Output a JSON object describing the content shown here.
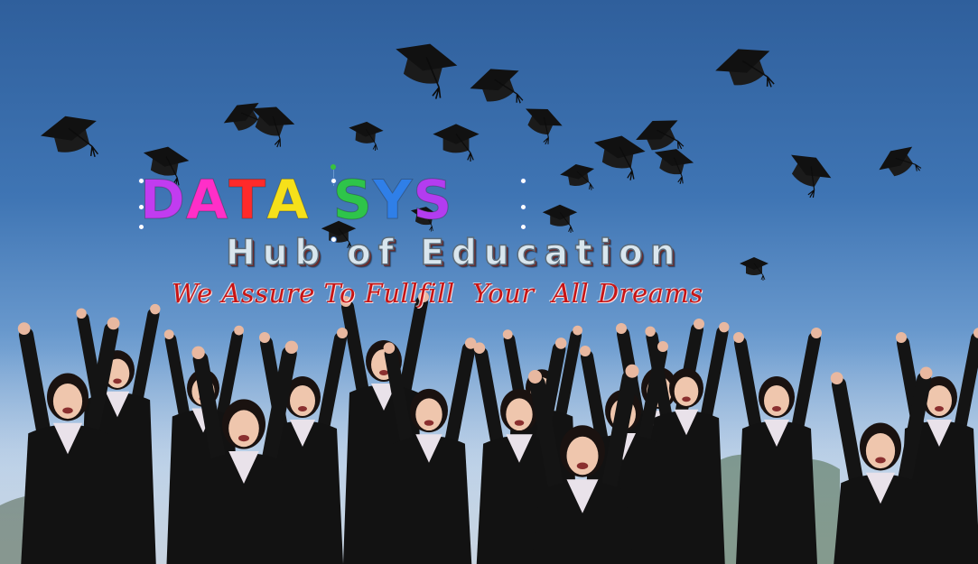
{
  "banner": {
    "headline_words": [
      [
        {
          "ch": "D",
          "color": "#c13cf0"
        },
        {
          "ch": "A",
          "color": "#ff2fc8"
        },
        {
          "ch": "T",
          "color": "#ff2a2a"
        },
        {
          "ch": "A",
          "color": "#f6e01a"
        }
      ],
      [
        {
          "ch": "S",
          "color": "#2ec44a"
        },
        {
          "ch": "Y",
          "color": "#2f7fe8"
        },
        {
          "ch": "S",
          "color": "#b33cf0"
        }
      ]
    ],
    "subtitle": "Hub of Education",
    "tagline": "We Assure To Fullfill  Your  All Dreams"
  },
  "colors": {
    "sky_top": "#2f5f9c",
    "tagline_red": "#c81414",
    "gown_black": "#111111"
  }
}
